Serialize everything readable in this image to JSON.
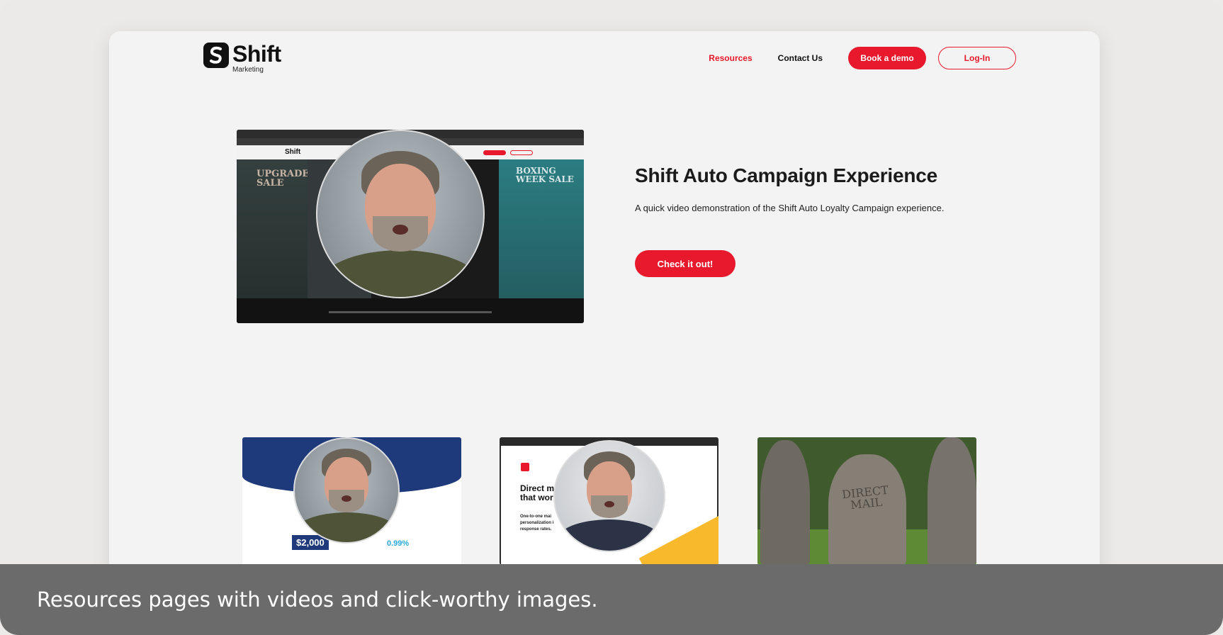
{
  "nav": {
    "logo_name": "Shift",
    "logo_sub": "Marketing",
    "links": [
      {
        "label": "Resources",
        "active": true
      },
      {
        "label": "Contact Us",
        "active": false
      }
    ],
    "demo_button": "Book a demo",
    "login_button": "Log-In"
  },
  "hero": {
    "title": "Shift Auto Campaign Experience",
    "description": "A quick video demonstration of the Shift Auto Loyalty Campaign experience.",
    "cta": "Check it out!",
    "video": {
      "logo": "Shift",
      "left_text": "UPGRADE SALE",
      "right_text": "BOXING WEEK SALE"
    }
  },
  "cards": [
    {
      "price": "$2,000",
      "rate": "0.99%"
    },
    {
      "title": "Direct m\nthat wor",
      "body": "One-to-one mai\npersonalization i\nresponse rates."
    },
    {
      "stone_text": "DIRECT\nMAIL"
    }
  ],
  "caption": "Resources pages with videos and click-worthy images.",
  "colors": {
    "brand_red": "#e8192c",
    "dark": "#111111",
    "caption_bg": "#6b6b6b"
  }
}
